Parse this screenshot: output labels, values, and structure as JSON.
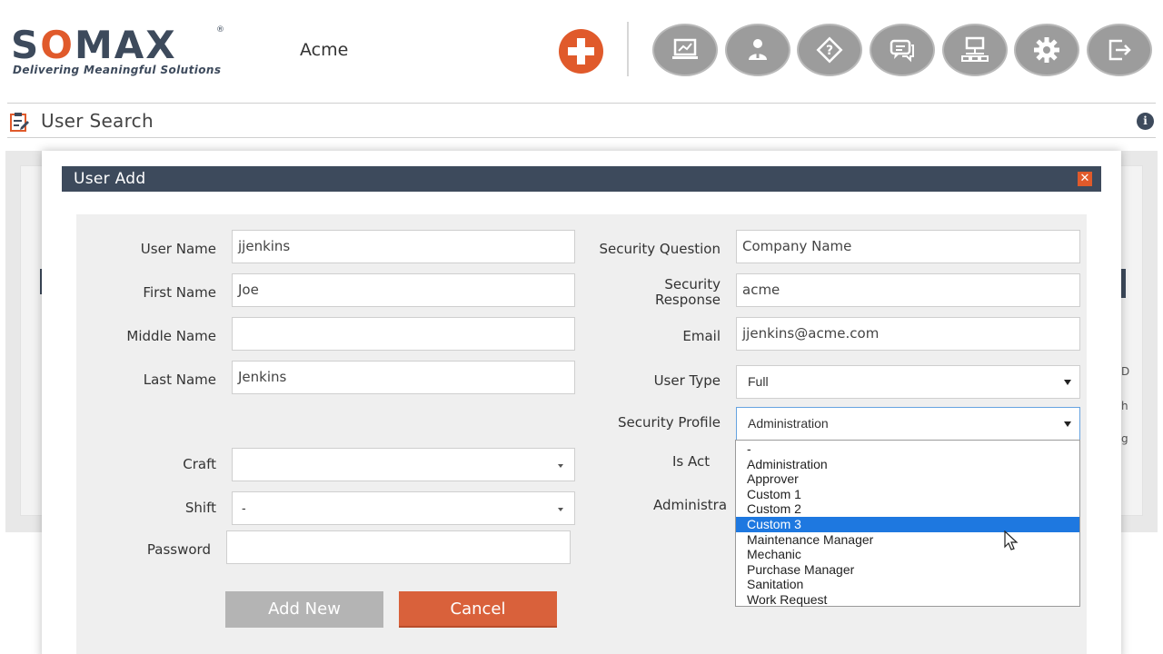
{
  "header": {
    "logo_word_prefix": "S",
    "logo_word_o": "O",
    "logo_word_suffix": "MAX",
    "logo_registered": "®",
    "logo_tagline": "Delivering Meaningful Solutions",
    "company_name": "Acme",
    "nav_icons": [
      "dashboard-icon",
      "users-icon",
      "help-icon",
      "chat-icon",
      "network-icon",
      "settings-icon",
      "logout-icon"
    ]
  },
  "page": {
    "title": "User Search",
    "info_glyph": "i"
  },
  "background": {
    "edge_letters": [
      "D",
      "h",
      "g"
    ]
  },
  "modal": {
    "title": "User Add",
    "close_glyph": "✕",
    "left_fields": {
      "user_name_label": "User Name",
      "user_name_value": "jjenkins",
      "first_name_label": "First Name",
      "first_name_value": "Joe",
      "middle_name_label": "Middle Name",
      "middle_name_value": "",
      "last_name_label": "Last Name",
      "last_name_value": "Jenkins",
      "craft_label": "Craft",
      "craft_value": "",
      "shift_label": "Shift",
      "shift_value": "-",
      "password_label": "Password",
      "password_value": ""
    },
    "right_fields": {
      "security_question_label": "Security Question",
      "security_question_value": "Company Name",
      "security_response_label_1": "Security",
      "security_response_label_2": "Response",
      "security_response_value": "acme",
      "email_label": "Email",
      "email_value": "jjenkins@acme.com",
      "user_type_label": "User Type",
      "user_type_value": "Full",
      "security_profile_label": "Security Profile",
      "security_profile_value": "Administration",
      "is_active_label": "Is Act",
      "administrator_label": "Administra"
    },
    "buttons": {
      "add_new": "Add New",
      "cancel": "Cancel"
    },
    "security_profile_options": [
      "-",
      "Administration",
      "Approver",
      "Custom 1",
      "Custom 2",
      "Custom 3",
      "Maintenance Manager",
      "Mechanic",
      "Purchase Manager",
      "Sanitation",
      "Work Request"
    ],
    "highlighted_option": "Custom 3"
  },
  "colors": {
    "brand_dark": "#3d4a5c",
    "brand_accent": "#e05a2b",
    "nav_icon_gray": "#9c9c9c",
    "selection_blue": "#1e78e0",
    "cancel_orange": "#d9613b",
    "add_disabled_gray": "#b4b4b4"
  }
}
